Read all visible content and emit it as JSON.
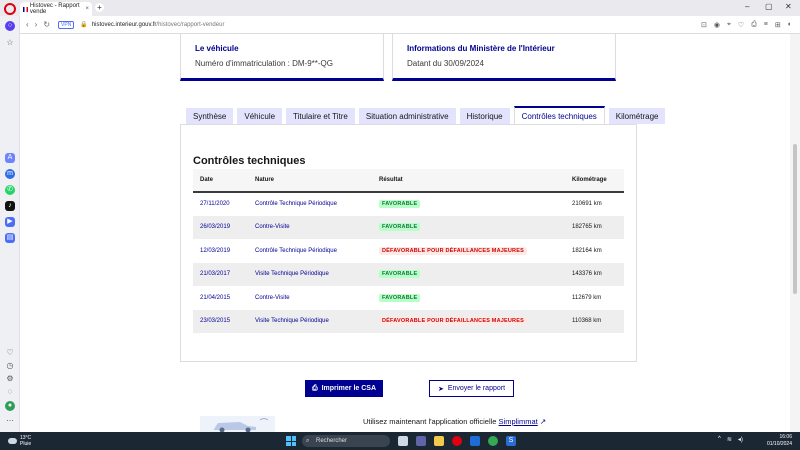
{
  "browser": {
    "tab_title": "Histovec - Rapport vende",
    "tab_close": "×",
    "new_tab": "+",
    "url_badge": "VPN",
    "url_host": "histovec.interieur.gouv.fr",
    "url_path": "/histovec/rapport-vendeur",
    "window_controls": [
      "–",
      "▢",
      "✕"
    ]
  },
  "cards": [
    {
      "title": "Le véhicule",
      "text": "Numéro d'immatriculation : DM-9**-QG"
    },
    {
      "title": "Informations du Ministère de l'Intérieur",
      "text": "Datant du 30/09/2024"
    }
  ],
  "tabs": [
    {
      "label": "Synthèse",
      "active": false
    },
    {
      "label": "Véhicule",
      "active": false
    },
    {
      "label": "Titulaire et Titre",
      "active": false
    },
    {
      "label": "Situation administrative",
      "active": false
    },
    {
      "label": "Historique",
      "active": false
    },
    {
      "label": "Contrôles techniques",
      "active": true
    },
    {
      "label": "Kilométrage",
      "active": false
    }
  ],
  "controles": {
    "heading": "Contrôles techniques",
    "columns": [
      "Date",
      "Nature",
      "Résultat",
      "Kilométrage"
    ],
    "rows": [
      {
        "date": "27/11/2020",
        "nature": "Contrôle Technique Périodique",
        "resultat": "FAVORABLE",
        "status": "fav",
        "km": "210691 km"
      },
      {
        "date": "26/03/2019",
        "nature": "Contre-Visite",
        "resultat": "FAVORABLE",
        "status": "fav",
        "km": "182765 km"
      },
      {
        "date": "12/03/2019",
        "nature": "Contrôle Technique Périodique",
        "resultat": "DÉFAVORABLE POUR DÉFAILLANCES MAJEURES",
        "status": "defav",
        "km": "182164 km"
      },
      {
        "date": "21/03/2017",
        "nature": "Visite Technique Périodique",
        "resultat": "FAVORABLE",
        "status": "fav",
        "km": "143376 km"
      },
      {
        "date": "21/04/2015",
        "nature": "Contre-Visite",
        "resultat": "FAVORABLE",
        "status": "fav",
        "km": "112679 km"
      },
      {
        "date": "23/03/2015",
        "nature": "Visite Technique Périodique",
        "resultat": "DÉFAVORABLE POUR DÉFAILLANCES MAJEURES",
        "status": "defav",
        "km": "110368 km"
      }
    ]
  },
  "actions": {
    "print_label": "Imprimer le CSA",
    "send_label": "Envoyer le rapport"
  },
  "promo": {
    "text": "Utilisez maintenant l'application officielle",
    "link": "Simplimmat"
  },
  "taskbar": {
    "temperature": "13°C",
    "weather": "Pluie",
    "search_placeholder": "Rechercher",
    "time": "16:06",
    "date": "01/10/2024"
  },
  "colors": {
    "primary": "#000091",
    "favorable_bg": "#b8fec9",
    "favorable_fg": "#18753c",
    "defavorable_bg": "#ffe9e6",
    "defavorable_fg": "#ce0500"
  }
}
